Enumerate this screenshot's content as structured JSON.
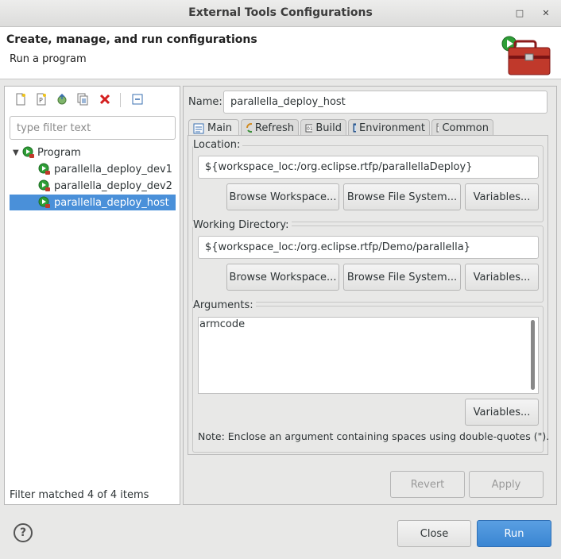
{
  "window": {
    "title": "External Tools Configurations"
  },
  "header": {
    "title": "Create, manage, and run configurations",
    "description": "Run a program"
  },
  "left": {
    "filter_placeholder": "type filter text",
    "tree": {
      "root": "Program",
      "children": [
        "parallella_deploy_dev1",
        "parallella_deploy_dev2",
        "parallella_deploy_host"
      ],
      "selected_index": 2
    },
    "filter_status": "Filter matched 4 of 4 items"
  },
  "right": {
    "name_label": "Name:",
    "name_value": "parallella_deploy_host",
    "tabs": [
      "Main",
      "Refresh",
      "Build",
      "Environment",
      "Common"
    ],
    "active_tab": "Main",
    "location": {
      "label": "Location:",
      "value": "${workspace_loc:/org.eclipse.rtfp/parallellaDeploy}",
      "buttons": [
        "Browse Workspace...",
        "Browse File System...",
        "Variables..."
      ]
    },
    "working_dir": {
      "label": "Working Directory:",
      "value": "${workspace_loc:/org.eclipse.rtfp/Demo/parallella}",
      "buttons": [
        "Browse Workspace...",
        "Browse File System...",
        "Variables..."
      ]
    },
    "arguments": {
      "label": "Arguments:",
      "value": "armcode",
      "variables_button": "Variables...",
      "note": "Note: Enclose an argument containing spaces using double-quotes (\")."
    },
    "revert": "Revert",
    "apply": "Apply"
  },
  "footer": {
    "close": "Close",
    "run": "Run"
  },
  "colors": {
    "selection": "#4a90d9",
    "run_button": "#3a85d2"
  }
}
